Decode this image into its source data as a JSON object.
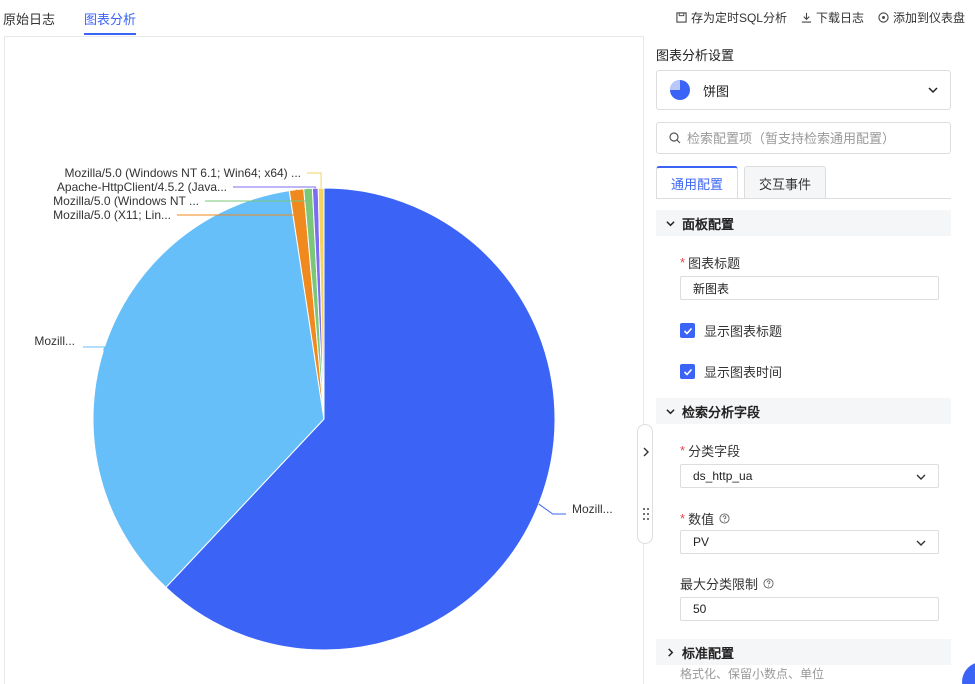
{
  "tabs": {
    "raw_logs": "原始日志",
    "chart_analysis": "图表分析"
  },
  "actions": {
    "save_sql": "存为定时SQL分析",
    "download": "下载日志",
    "add_dashboard": "添加到仪表盘"
  },
  "colors": {
    "accent": "#3b64f6",
    "required": "#e5484d"
  },
  "chart_data": {
    "type": "pie",
    "slices": [
      {
        "label": "Mozill...",
        "value": 62.0,
        "color": "#3b64f6"
      },
      {
        "label": "Mozill...",
        "value": 35.6,
        "color": "#66bff9"
      },
      {
        "label": "Mozilla/5.0 (X11; Lin...",
        "value": 1.0,
        "color": "#f0891e"
      },
      {
        "label": "Mozilla/5.0 (Windows NT ...",
        "value": 0.6,
        "color": "#7ac77a"
      },
      {
        "label": "Apache-HttpClient/4.5.2 (Java...",
        "value": 0.4,
        "color": "#7c6cf0"
      },
      {
        "label": "Mozilla/5.0 (Windows NT 6.1; Win64; x64) ...",
        "value": 0.4,
        "color": "#f4d35e"
      }
    ]
  },
  "panel": {
    "title": "图表分析设置",
    "chart_type": "饼图",
    "search_placeholder": "检索配置项（暂支持检索通用配置）",
    "subtabs": [
      "通用配置",
      "交互事件"
    ],
    "section_panel": "面板配置",
    "chart_title_label": "图表标题",
    "chart_title_value": "新图表",
    "show_title": "显示图表标题",
    "show_time": "显示图表时间",
    "section_fields": "检索分析字段",
    "category_label": "分类字段",
    "category_value": "ds_http_ua",
    "value_label": "数值",
    "value_value": "PV",
    "max_label": "最大分类限制",
    "max_value": "50",
    "section_standard": "标准配置",
    "standard_hint": "格式化、保留小数点、单位",
    "required_mark": "*"
  }
}
